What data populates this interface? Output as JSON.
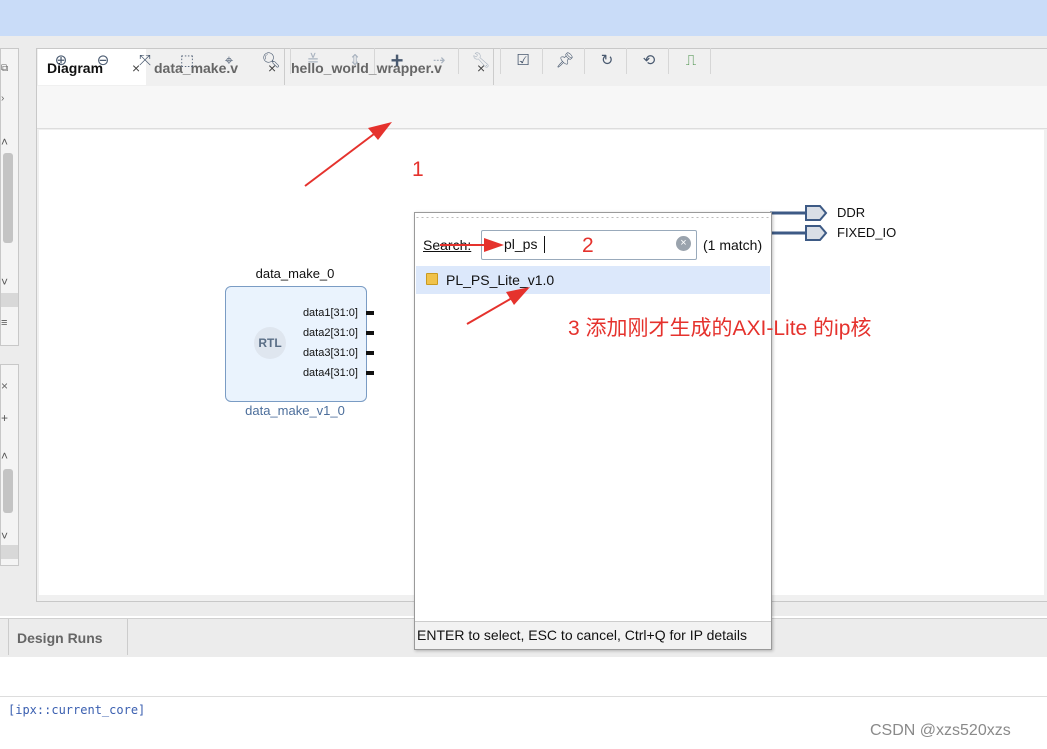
{
  "tabs": [
    {
      "label": "Diagram",
      "close": "×"
    },
    {
      "label": "data_make.v",
      "close": "×"
    },
    {
      "label": "hello_world_wrapper.v",
      "close": "×"
    }
  ],
  "toolbar_icons": [
    "zoom-in-icon",
    "zoom-out-icon",
    "fit-view-icon",
    "zoom-selection-icon",
    "auto-connect-icon",
    "search-icon",
    "collapse-icon",
    "expand-icon",
    "add-ip-icon",
    "make-connection-icon",
    "properties-icon",
    "validate-icon",
    "pin-icon",
    "regenerate-icon",
    "optimize-routing-icon",
    "debug-icon"
  ],
  "block": {
    "instance_name": "data_make_0",
    "logo": "RTL",
    "module_name": "data_make_v1_0",
    "ports": [
      "data1[31:0]",
      "data2[31:0]",
      "data3[31:0]",
      "data4[31:0]"
    ]
  },
  "external_ports": [
    "DDR",
    "FIXED_IO"
  ],
  "popup": {
    "search_label": "Search:",
    "search_value": "pl_ps",
    "match_count": "(1 match)",
    "results": [
      "PL_PS_Lite_v1.0"
    ],
    "footer": "ENTER to select, ESC to cancel, Ctrl+Q for IP details"
  },
  "annotations": {
    "step1": "1",
    "step2": "2",
    "step3": "3 添加刚才生成的AXI-Lite 的ip核"
  },
  "bottom_tab": "Design Runs",
  "console_text": "[ipx::current_core]",
  "watermark": "CSDN @xzs520xzs",
  "colors": {
    "annotation": "#e5322d",
    "selection": "#dce8fb",
    "port_line": "#3d5a85"
  }
}
